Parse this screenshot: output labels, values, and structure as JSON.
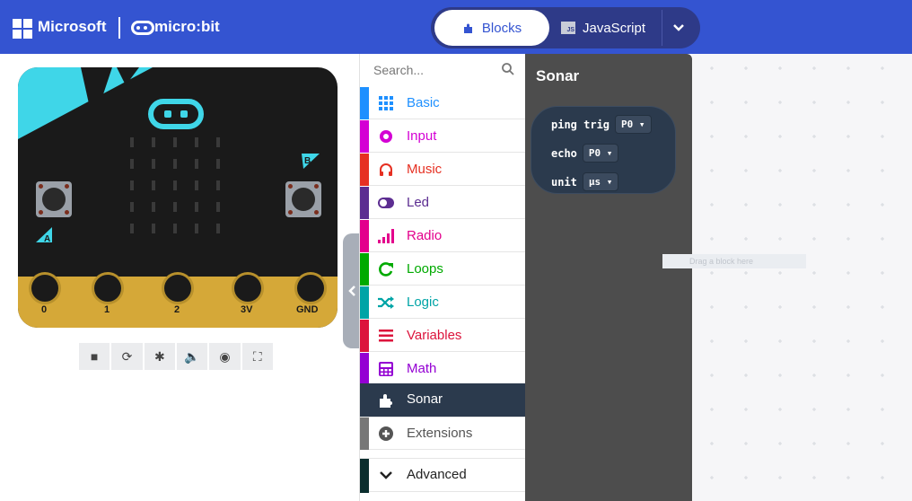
{
  "header": {
    "ms_text": "Microsoft",
    "microbit_text": "micro:bit",
    "blocks_label": "Blocks",
    "js_label": "JavaScript",
    "js_badge": "JS",
    "colors": {
      "header_bg": "#3454d1",
      "toggle_bg": "#2e3a88"
    }
  },
  "simulator": {
    "pins": [
      "0",
      "1",
      "2",
      "3V",
      "GND"
    ],
    "button_a": "A",
    "button_b": "B",
    "tools": [
      "stop-icon",
      "restart-icon",
      "debug-icon",
      "sound-icon",
      "screenshot-icon",
      "fullscreen-icon"
    ]
  },
  "toolbox": {
    "search_placeholder": "Search...",
    "categories": [
      {
        "label": "Basic",
        "color": "#1e90ff",
        "icon": "grid-icon"
      },
      {
        "label": "Input",
        "color": "#d400d4",
        "icon": "circle-icon"
      },
      {
        "label": "Music",
        "color": "#e63022",
        "icon": "headphones-icon"
      },
      {
        "label": "Led",
        "color": "#5c2d91",
        "icon": "toggle-icon"
      },
      {
        "label": "Radio",
        "color": "#e3008c",
        "icon": "signal-icon"
      },
      {
        "label": "Loops",
        "color": "#00aa00",
        "icon": "loop-icon"
      },
      {
        "label": "Logic",
        "color": "#00a4a6",
        "icon": "shuffle-icon"
      },
      {
        "label": "Variables",
        "color": "#dc143c",
        "icon": "lines-icon"
      },
      {
        "label": "Math",
        "color": "#9400d3",
        "icon": "calculator-icon"
      },
      {
        "label": "Sonar",
        "color": "#2b3a4d",
        "icon": "puzzle-icon"
      },
      {
        "label": "Extensions",
        "color": "#777777",
        "icon": "plus-circle-icon"
      },
      {
        "label": "Advanced",
        "color": "#0b2e2e",
        "icon": "chevron-down-icon"
      }
    ]
  },
  "flyout": {
    "title": "Sonar",
    "block": {
      "row1_label": "ping trig",
      "row1_value": "P0",
      "row2_label": "echo",
      "row2_value": "P0",
      "row3_label": "unit",
      "row3_value": "μs"
    }
  },
  "workspace": {
    "ghost_text": "Drag a block here"
  }
}
